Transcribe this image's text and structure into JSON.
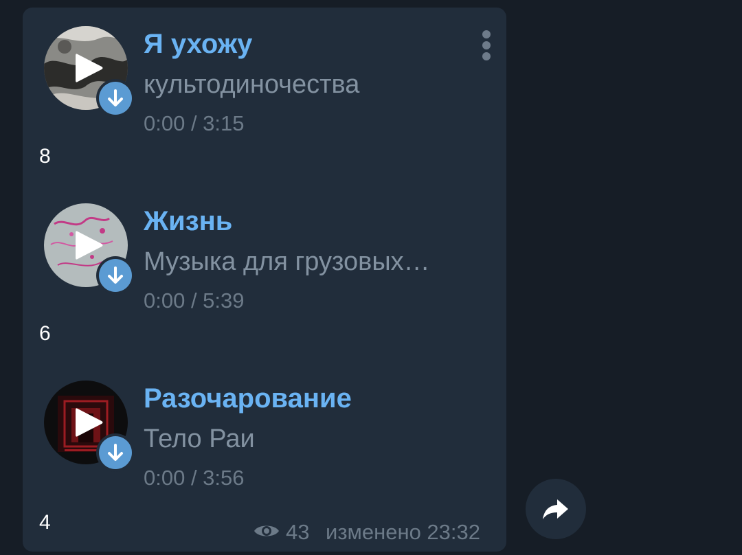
{
  "tracks": [
    {
      "title": "Я ухожу",
      "artist": "культодиночества",
      "time": "0:00 / 3:15",
      "count": "8"
    },
    {
      "title": "Жизнь",
      "artist": "Музыка для грузовых…",
      "time": "0:00 / 5:39",
      "count": "6"
    },
    {
      "title": "Разочарование",
      "artist": "Тело Раи",
      "time": "0:00 / 3:56",
      "count": "4"
    }
  ],
  "footer": {
    "views": "43",
    "edited": "изменено 23:32"
  },
  "icons": {
    "menu": "more-vertical-icon",
    "play": "play-icon",
    "download": "download-arrow-icon",
    "views": "eye-icon",
    "forward": "share-forward-icon"
  },
  "colors": {
    "background": "#161d26",
    "bubble": "#212d3b",
    "title": "#6ab3f3",
    "secondary_text": "#8392a1",
    "download_badge": "#5b9bd3"
  }
}
